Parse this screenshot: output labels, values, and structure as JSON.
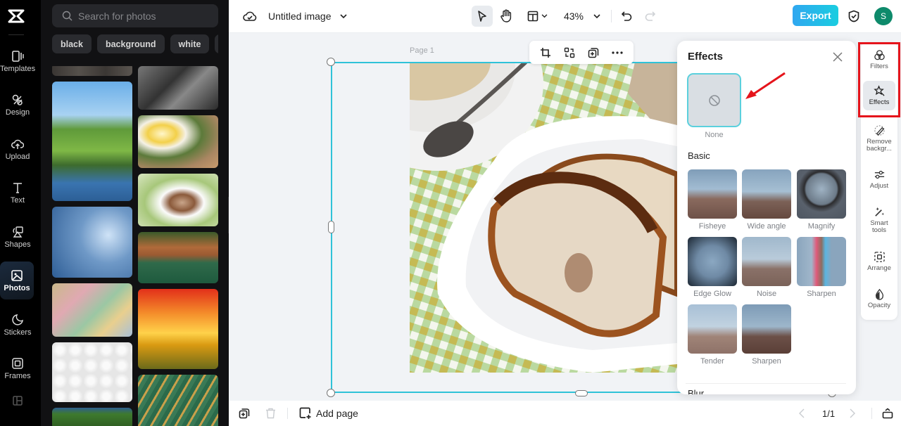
{
  "rail": {
    "items": [
      {
        "label": "Templates",
        "icon": "templates-icon"
      },
      {
        "label": "Design",
        "icon": "design-icon"
      },
      {
        "label": "Upload",
        "icon": "upload-icon"
      },
      {
        "label": "Text",
        "icon": "text-icon"
      },
      {
        "label": "Shapes",
        "icon": "shapes-icon"
      },
      {
        "label": "Photos",
        "icon": "photos-icon",
        "active": true
      },
      {
        "label": "Stickers",
        "icon": "stickers-icon"
      },
      {
        "label": "Frames",
        "icon": "frames-icon"
      }
    ]
  },
  "panel": {
    "search_placeholder": "Search for photos",
    "chips": [
      "black",
      "background",
      "white",
      "y"
    ]
  },
  "topbar": {
    "title": "Untitled image",
    "zoom": "43%",
    "export_label": "Export",
    "avatar_initial": "S"
  },
  "canvas": {
    "page_label": "Page 1"
  },
  "effects": {
    "title": "Effects",
    "none_label": "None",
    "section_basic": "Basic",
    "section_blur": "Blur",
    "items": [
      "Fisheye",
      "Wide angle",
      "Magnify",
      "Edge Glow",
      "Noise",
      "Sharpen",
      "Tender",
      "Sharpen"
    ]
  },
  "tools": {
    "items": [
      {
        "label": "Filters"
      },
      {
        "label": "Effects",
        "active": true
      },
      {
        "label": "Remove backgr..."
      },
      {
        "label": "Adjust"
      },
      {
        "label": "Smart tools"
      },
      {
        "label": "Arrange"
      },
      {
        "label": "Opacity"
      }
    ]
  },
  "bottombar": {
    "add_page_label": "Add page",
    "page_indicator": "1/1"
  },
  "colors": {
    "accent": "#2fc2d8",
    "export_start": "#30a7f0",
    "export_end": "#19cde0",
    "avatar": "#0e8a6b",
    "highlight": "#e5141b"
  }
}
